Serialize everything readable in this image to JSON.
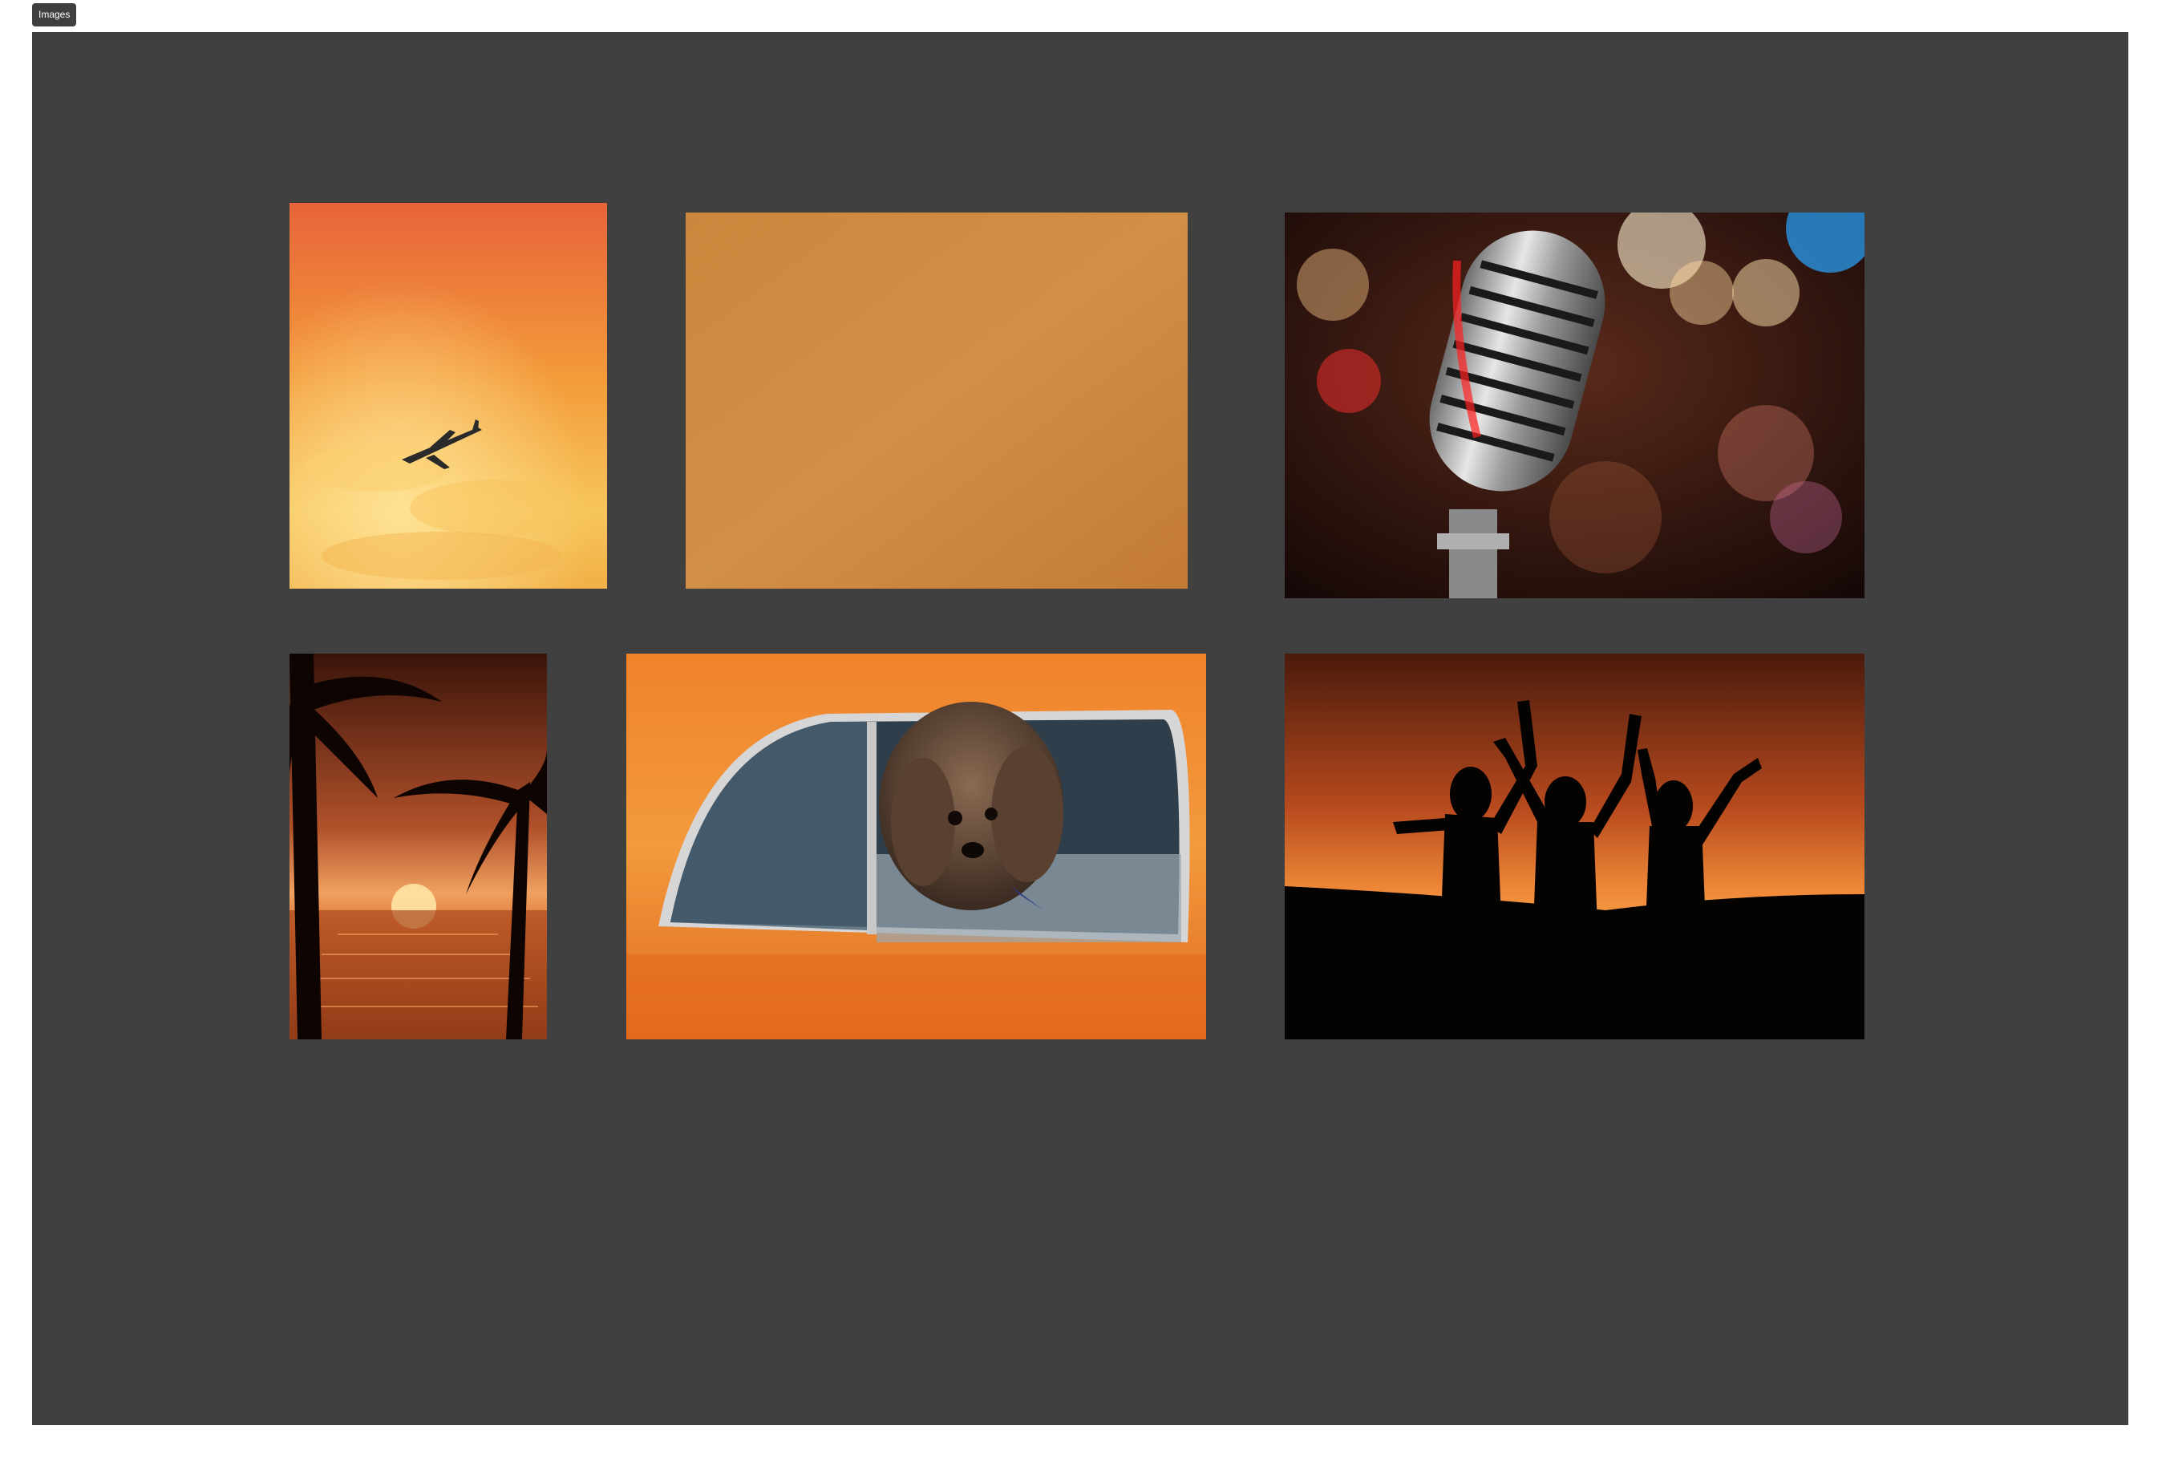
{
  "toolbar": {
    "tab_label": "Images"
  },
  "gallery": {
    "background_color": "#404040",
    "images": [
      {
        "name": "airplane-sunset",
        "accent": "#f39a3a"
      },
      {
        "name": "sand-texture",
        "accent": "#d98a3c"
      },
      {
        "name": "vintage-microphone",
        "accent": "#c0c0c0"
      },
      {
        "name": "palm-trees-sunset",
        "accent": "#e07a3a"
      },
      {
        "name": "dog-in-orange-car",
        "accent": "#f08a2a"
      },
      {
        "name": "dancing-silhouettes",
        "accent": "#e8782a"
      }
    ]
  }
}
